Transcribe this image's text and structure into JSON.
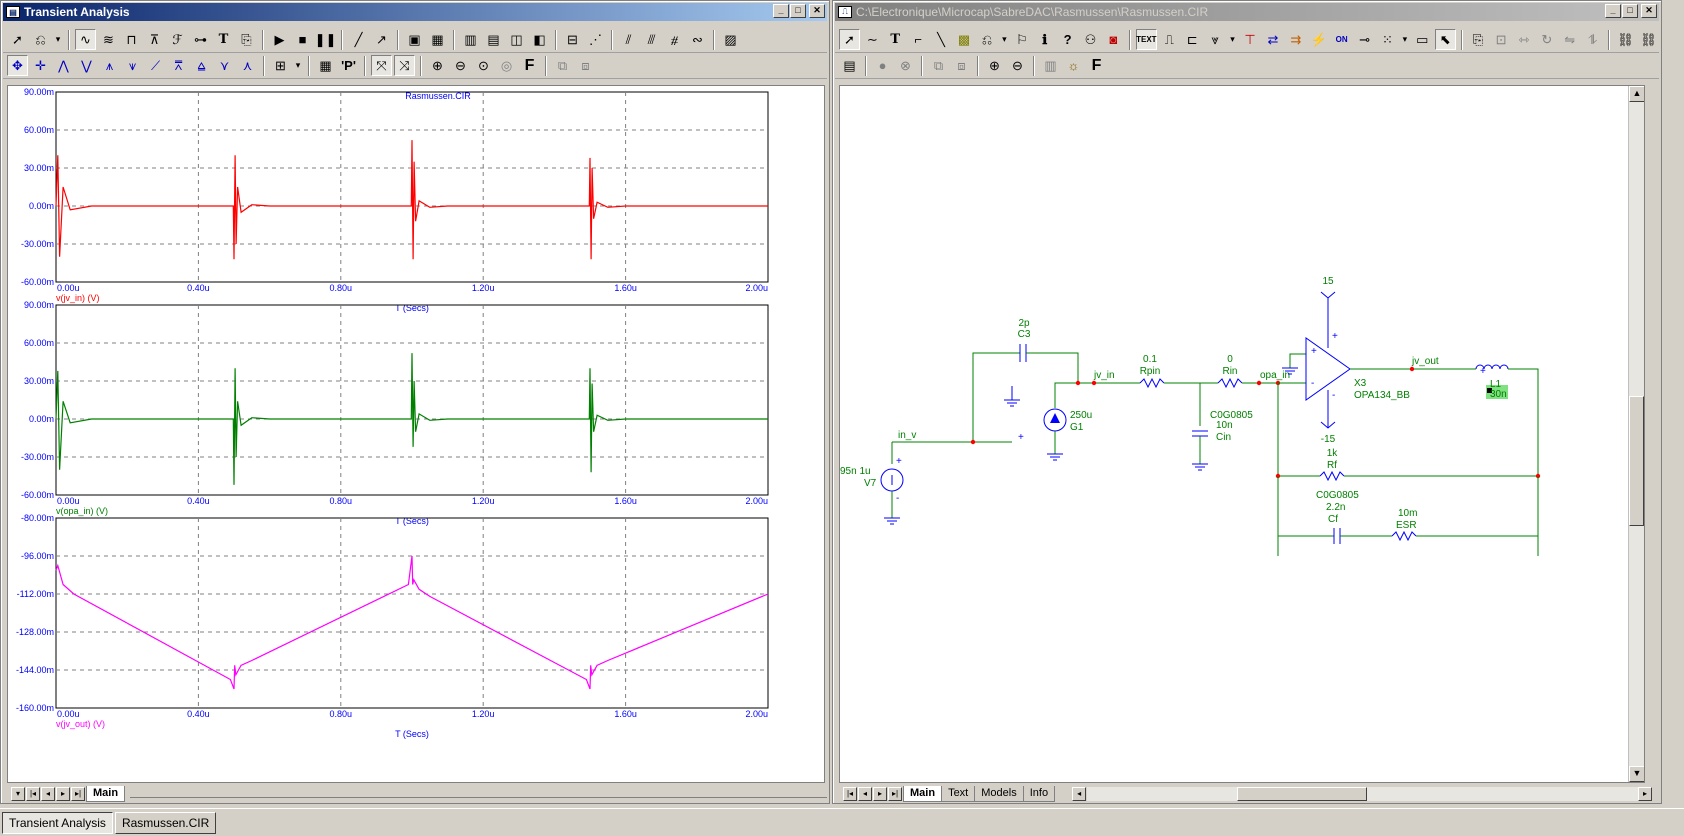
{
  "left_window": {
    "title": "Transient Analysis",
    "tabs": [
      "Main"
    ]
  },
  "right_window": {
    "title": "C:\\Electronique\\Microcap\\SabreDAC\\Rasmussen\\Rasmussen.CIR",
    "tabs": [
      "Main",
      "Text",
      "Models",
      "Info"
    ]
  },
  "taskbar": {
    "items": [
      "Transient Analysis",
      "Rasmussen.CIR"
    ]
  },
  "colors": {
    "plot1": "#ff0000",
    "plot2": "#008000",
    "plot3": "#ff00ff",
    "axis_text": "#0000ff",
    "schematic_wire": "#008000",
    "schematic_component": "#0000ff",
    "node_dot": "#ff0000"
  },
  "chart_data": [
    {
      "type": "line",
      "title": "Rasmussen.CIR",
      "xlabel": "T (Secs)",
      "ylabel": "v(jv_in) (V)",
      "xticks": [
        "0.00u",
        "0.40u",
        "0.80u",
        "1.20u",
        "1.60u",
        "2.00u"
      ],
      "yticks": [
        "90.00m",
        "60.00m",
        "30.00m",
        "0.00m",
        "-30.00m",
        "-60.00m"
      ],
      "xlim": [
        0,
        2.0
      ],
      "ylim": [
        -60,
        90
      ],
      "series": [
        {
          "name": "v(jv_in) (V)",
          "x": [
            0,
            0.005,
            0.01,
            0.02,
            0.04,
            0.1,
            0.498,
            0.5,
            0.503,
            0.506,
            0.51,
            0.52,
            0.55,
            0.6,
            0.998,
            1.0,
            1.003,
            1.006,
            1.01,
            1.02,
            1.05,
            1.1,
            1.498,
            1.5,
            1.503,
            1.506,
            1.51,
            1.52,
            1.55,
            1.6,
            2.0
          ],
          "y": [
            0,
            40,
            -40,
            15,
            -3,
            0,
            0,
            -42,
            40,
            -30,
            15,
            -5,
            1,
            0,
            0,
            52,
            -42,
            35,
            -12,
            4,
            -1,
            0,
            0,
            38,
            -42,
            30,
            -10,
            3,
            -1,
            0,
            0
          ]
        }
      ]
    },
    {
      "type": "line",
      "title": "",
      "xlabel": "T (Secs)",
      "ylabel": "v(opa_in) (V)",
      "xticks": [
        "0.00u",
        "0.40u",
        "0.80u",
        "1.20u",
        "1.60u",
        "2.00u"
      ],
      "yticks": [
        "90.00m",
        "60.00m",
        "30.00m",
        "0.00m",
        "-30.00m",
        "-60.00m"
      ],
      "xlim": [
        0,
        2.0
      ],
      "ylim": [
        -60,
        90
      ],
      "series": [
        {
          "name": "v(opa_in) (V)",
          "x": [
            0,
            0.005,
            0.01,
            0.02,
            0.04,
            0.1,
            0.498,
            0.5,
            0.503,
            0.506,
            0.51,
            0.52,
            0.55,
            0.6,
            0.998,
            1.0,
            1.003,
            1.006,
            1.01,
            1.02,
            1.05,
            1.1,
            1.498,
            1.5,
            1.503,
            1.506,
            1.51,
            1.52,
            1.55,
            1.6,
            2.0
          ],
          "y": [
            0,
            38,
            -40,
            14,
            -3,
            0,
            0,
            -52,
            40,
            -30,
            14,
            -5,
            1,
            0,
            0,
            52,
            -22,
            30,
            -10,
            4,
            -1,
            0,
            0,
            40,
            -42,
            28,
            -10,
            3,
            -1,
            0,
            0
          ]
        }
      ]
    },
    {
      "type": "line",
      "title": "",
      "xlabel": "T (Secs)",
      "ylabel": "v(jv_out) (V)",
      "xticks": [
        "0.00u",
        "0.40u",
        "0.80u",
        "1.20u",
        "1.60u",
        "2.00u"
      ],
      "yticks": [
        "-80.00m",
        "-96.00m",
        "-112.00m",
        "-128.00m",
        "-144.00m",
        "-160.00m"
      ],
      "xlim": [
        0,
        2.0
      ],
      "ylim": [
        -160,
        -80
      ],
      "series": [
        {
          "name": "v(jv_out) (V)",
          "x": [
            0,
            0.005,
            0.02,
            0.05,
            0.49,
            0.5,
            0.502,
            0.505,
            0.52,
            0.55,
            0.99,
            1.0,
            1.002,
            1.005,
            1.02,
            1.05,
            1.49,
            1.5,
            1.502,
            1.505,
            1.52,
            1.55,
            2.0
          ],
          "y": [
            -102,
            -100,
            -108,
            -112,
            -148,
            -152,
            -142,
            -146,
            -142,
            -140,
            -108,
            -96,
            -108,
            -106,
            -110,
            -113,
            -148,
            -152,
            -142,
            -146,
            -142,
            -140,
            -112
          ]
        }
      ]
    }
  ],
  "schematic": {
    "labels": {
      "c3_val": "2p",
      "c3_name": "C3",
      "rpin_val": "0.1",
      "rpin_name": "Rpin",
      "rin_val": "0",
      "rin_name": "Rin",
      "cin_model": "C0G0805",
      "cin_val": "10n",
      "cin_name": "Cin",
      "g1_val": "250u",
      "g1_name": "G1",
      "v7_val": "95n  1u",
      "v7_name": "V7",
      "x3_name": "X3",
      "x3_model": "OPA134_BB",
      "vplus": "15",
      "vminus": "-15",
      "rf_val": "1k",
      "rf_name": "Rf",
      "cf_model": "C0G0805",
      "cf_val": "2.2n",
      "cf_name": "Cf",
      "esr_val": "10m",
      "esr_name": "ESR",
      "l1_name": "L1",
      "l1_val": "30n",
      "node_in_v": "in_v",
      "node_jv_in": "jv_in",
      "node_opa_in": "opa_in",
      "node_jv_out": "jv_out",
      "plus": "+",
      "minus": "-"
    }
  }
}
